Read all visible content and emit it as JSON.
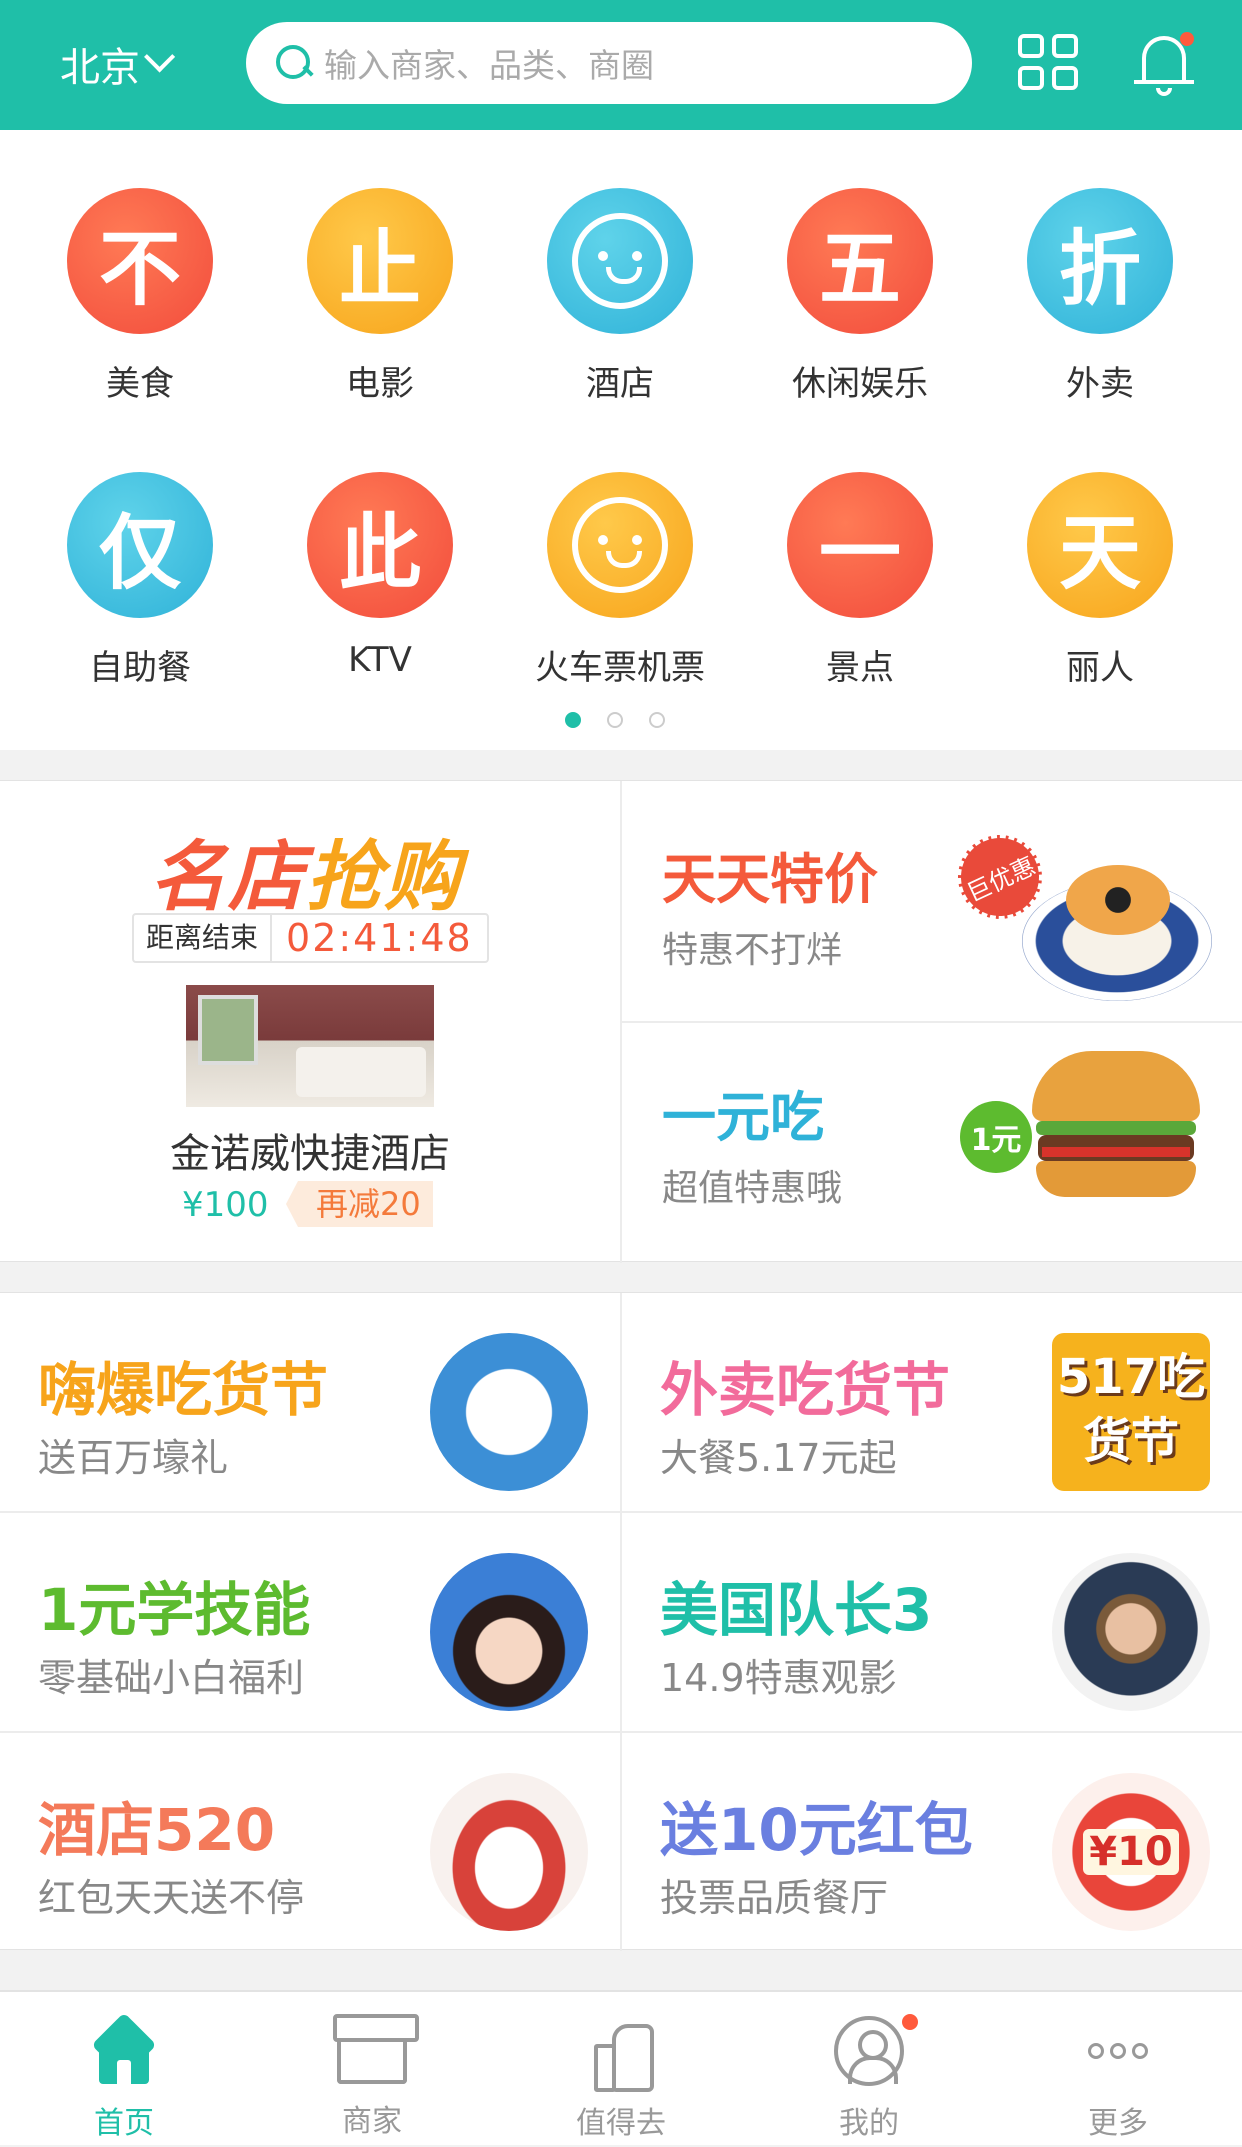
{
  "header": {
    "city": "北京",
    "search_placeholder": "输入商家、品类、商圈"
  },
  "categories": [
    {
      "glyph": "不",
      "label": "美食",
      "color": "red"
    },
    {
      "glyph": "止",
      "label": "电影",
      "color": "orange"
    },
    {
      "glyph": "",
      "label": "酒店",
      "color": "blue",
      "icon": "rabbit-face-icon"
    },
    {
      "glyph": "五",
      "label": "休闲娱乐",
      "color": "red"
    },
    {
      "glyph": "折",
      "label": "外卖",
      "color": "blue"
    },
    {
      "glyph": "仅",
      "label": "自助餐",
      "color": "blue"
    },
    {
      "glyph": "此",
      "label": "KTV",
      "color": "red"
    },
    {
      "glyph": "",
      "label": "火车票机票",
      "color": "orange",
      "icon": "smiley-face-icon"
    },
    {
      "glyph": "一",
      "label": "景点",
      "color": "red"
    },
    {
      "glyph": "天",
      "label": "丽人",
      "color": "orange"
    }
  ],
  "pager": {
    "pages": 3,
    "active": 0
  },
  "flash_sale": {
    "title_a": "名店",
    "title_b": "抢购",
    "countdown_label": "距离结束",
    "countdown_time": "02:41:48",
    "hotel_name": "金诺威快捷酒店",
    "price": "¥100",
    "discount_tag": "再减20"
  },
  "deals": [
    {
      "title": "天天特价",
      "subtitle": "特惠不打烊",
      "badge": "巨优惠",
      "color": "#f45a3b"
    },
    {
      "title": "一元吃",
      "subtitle": "超值特惠哦",
      "badge": "1元",
      "color": "#2fb2d8"
    }
  ],
  "activities": [
    {
      "title": "嗨爆吃货节",
      "subtitle": "送百万壕礼",
      "color": "#f7a41b",
      "pic": "milk"
    },
    {
      "title": "外卖吃货节",
      "subtitle": "大餐5.17元起",
      "color": "#f26b9b",
      "pic": "517",
      "pic_text": "517吃货节"
    },
    {
      "title": "1元学技能",
      "subtitle": "零基础小白福利",
      "color": "#5dbb2f",
      "pic": "girl"
    },
    {
      "title": "美国队长3",
      "subtitle": "14.9特惠观影",
      "color": "#1fbfa8",
      "pic": "cap"
    },
    {
      "title": "酒店520",
      "subtitle": "红包天天送不停",
      "color": "#f47a5a",
      "pic": "bed"
    },
    {
      "title": "送10元红包",
      "subtitle": "投票品质餐厅",
      "color": "#6a7fe0",
      "pic": "red",
      "pic_text": "¥10"
    }
  ],
  "tabbar": [
    {
      "label": "首页",
      "active": true
    },
    {
      "label": "商家",
      "active": false
    },
    {
      "label": "值得去",
      "active": false
    },
    {
      "label": "我的",
      "active": false,
      "badge": true
    },
    {
      "label": "更多",
      "active": false
    }
  ]
}
